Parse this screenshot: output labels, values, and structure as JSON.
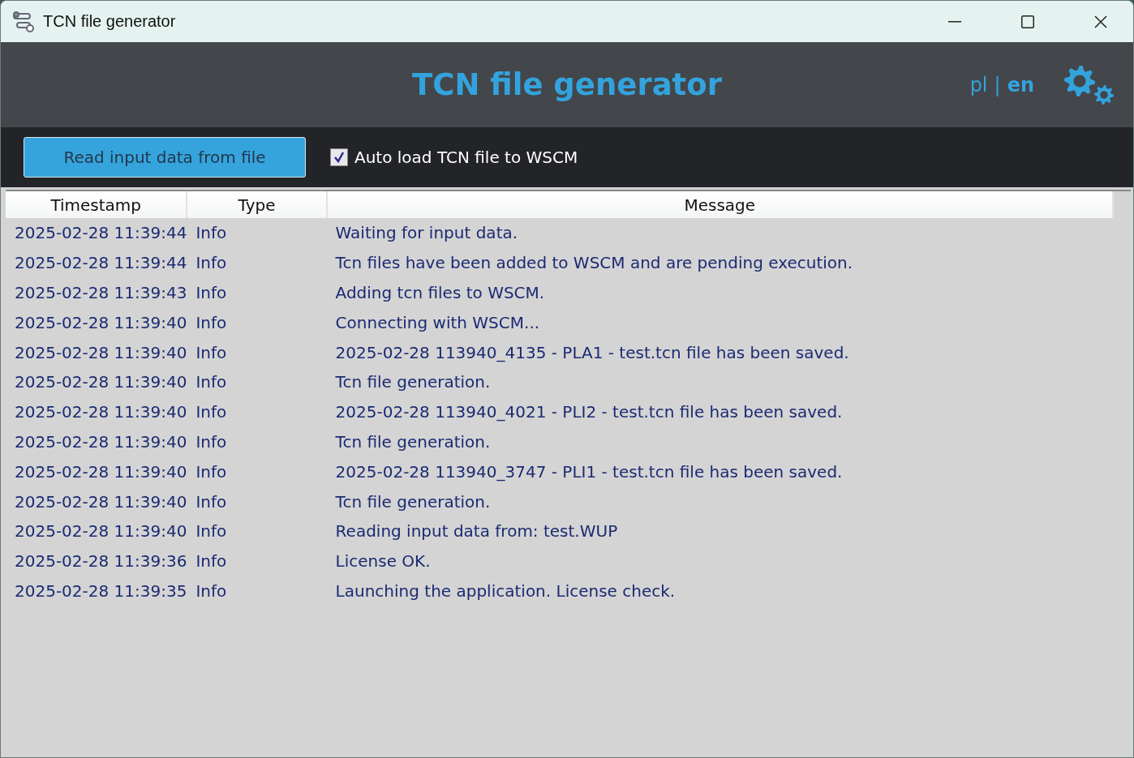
{
  "window": {
    "title": "TCN file generator"
  },
  "header": {
    "title": "TCN file generator",
    "languages": [
      {
        "label": "pl",
        "selected": false
      },
      {
        "label": "en",
        "selected": true
      }
    ],
    "separator": "|"
  },
  "toolbar": {
    "button": "Read input data from file",
    "auto_load": {
      "label": "Auto load TCN file to WSCM",
      "checked": true
    }
  },
  "table": {
    "columns": [
      "Timestamp",
      "Type",
      "Message"
    ],
    "rows": [
      {
        "timestamp": "2025-02-28 11:39:44",
        "type": "Info",
        "message": "Waiting for input data."
      },
      {
        "timestamp": "2025-02-28 11:39:44",
        "type": "Info",
        "message": "Tcn files have been added to WSCM and are pending execution."
      },
      {
        "timestamp": "2025-02-28 11:39:43",
        "type": "Info",
        "message": "Adding tcn files to WSCM."
      },
      {
        "timestamp": "2025-02-28 11:39:40",
        "type": "Info",
        "message": "Connecting with WSCM..."
      },
      {
        "timestamp": "2025-02-28 11:39:40",
        "type": "Info",
        "message": "2025-02-28 113940_4135 - PLA1 - test.tcn file has been saved."
      },
      {
        "timestamp": "2025-02-28 11:39:40",
        "type": "Info",
        "message": "Tcn file generation."
      },
      {
        "timestamp": "2025-02-28 11:39:40",
        "type": "Info",
        "message": "2025-02-28 113940_4021 - PLI2 - test.tcn file has been saved."
      },
      {
        "timestamp": "2025-02-28 11:39:40",
        "type": "Info",
        "message": "Tcn file generation."
      },
      {
        "timestamp": "2025-02-28 11:39:40",
        "type": "Info",
        "message": "2025-02-28 113940_3747 - PLI1 - test.tcn file has been saved."
      },
      {
        "timestamp": "2025-02-28 11:39:40",
        "type": "Info",
        "message": "Tcn file generation."
      },
      {
        "timestamp": "2025-02-28 11:39:40",
        "type": "Info",
        "message": "Reading input data from: test.WUP"
      },
      {
        "timestamp": "2025-02-28 11:39:36",
        "type": "Info",
        "message": "License OK."
      },
      {
        "timestamp": "2025-02-28 11:39:35",
        "type": "Info",
        "message": "Launching the application. License check."
      }
    ]
  }
}
